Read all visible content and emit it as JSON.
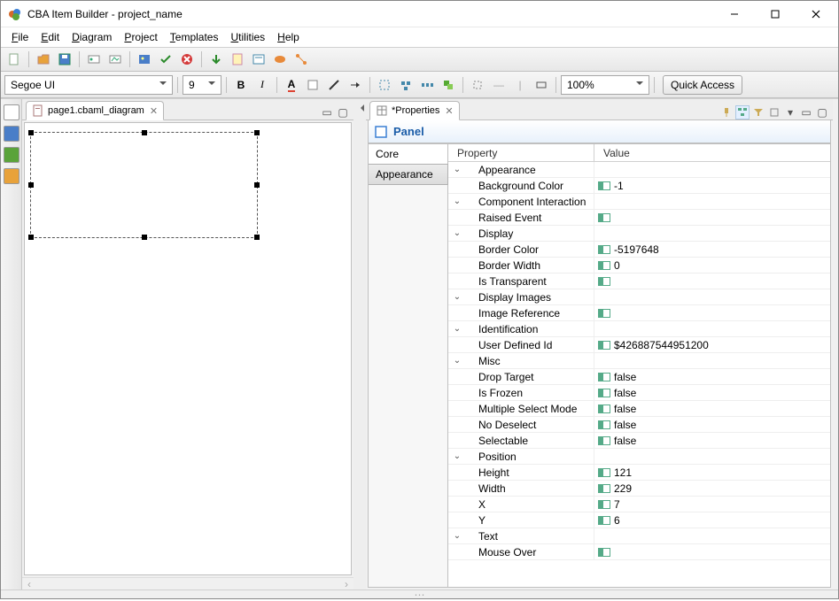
{
  "window": {
    "title": "CBA Item Builder - project_name"
  },
  "menu": {
    "file": "File",
    "edit": "Edit",
    "diagram": "Diagram",
    "project": "Project",
    "templates": "Templates",
    "utilities": "Utilities",
    "help": "Help"
  },
  "toolbar2": {
    "font": "Segoe UI",
    "size": "9",
    "bold": "B",
    "italic": "I",
    "fontcolor": "A",
    "zoom": "100%",
    "quick": "Quick Access"
  },
  "editorTab": {
    "label": "page1.cbaml_diagram"
  },
  "propsTab": {
    "label": "*Properties"
  },
  "propsHeader": {
    "label": "Panel"
  },
  "catList": {
    "core": "Core",
    "appearance": "Appearance"
  },
  "tableHeader": {
    "prop": "Property",
    "val": "Value"
  },
  "groups": {
    "appearance": "Appearance",
    "compInt": "Component Interaction",
    "display": "Display",
    "dispImg": "Display Images",
    "ident": "Identification",
    "misc": "Misc",
    "position": "Position",
    "text": "Text"
  },
  "props": {
    "bgColor": {
      "label": "Background Color",
      "value": "-1"
    },
    "raisedEvent": {
      "label": "Raised Event",
      "value": ""
    },
    "borderColor": {
      "label": "Border Color",
      "value": "-5197648"
    },
    "borderWidth": {
      "label": "Border Width",
      "value": "0"
    },
    "isTransparent": {
      "label": "Is Transparent",
      "value": ""
    },
    "imageRef": {
      "label": "Image Reference",
      "value": ""
    },
    "userId": {
      "label": "User Defined Id",
      "value": "$426887544951200"
    },
    "dropTarget": {
      "label": "Drop Target",
      "value": "false"
    },
    "isFrozen": {
      "label": "Is Frozen",
      "value": "false"
    },
    "multiSel": {
      "label": "Multiple Select Mode",
      "value": "false"
    },
    "noDeselect": {
      "label": "No Deselect",
      "value": "false"
    },
    "selectable": {
      "label": "Selectable",
      "value": "false"
    },
    "height": {
      "label": "Height",
      "value": "121"
    },
    "width": {
      "label": "Width",
      "value": "229"
    },
    "x": {
      "label": "X",
      "value": "7"
    },
    "y": {
      "label": "Y",
      "value": "6"
    },
    "mouseOver": {
      "label": "Mouse Over",
      "value": ""
    }
  }
}
